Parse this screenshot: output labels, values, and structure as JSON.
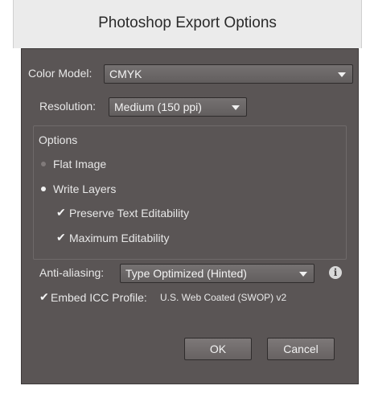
{
  "window": {
    "title": "Photoshop Export Options"
  },
  "color_model": {
    "label": "Color Model:",
    "value": "CMYK"
  },
  "resolution": {
    "label": "Resolution:",
    "value": "Medium (150 ppi)"
  },
  "options": {
    "heading": "Options",
    "flat_image": {
      "label": "Flat Image",
      "selected": false
    },
    "write_layers": {
      "label": "Write Layers",
      "selected": true
    },
    "preserve_text": {
      "label": "Preserve Text Editability",
      "checked": true
    },
    "max_edit": {
      "label": "Maximum Editability",
      "checked": true
    }
  },
  "anti_aliasing": {
    "label": "Anti-aliasing:",
    "value": "Type Optimized (Hinted)"
  },
  "embed_icc": {
    "label": "Embed ICC Profile:",
    "profile": "U.S. Web Coated (SWOP) v2",
    "checked": true
  },
  "buttons": {
    "ok": "OK",
    "cancel": "Cancel"
  },
  "colors": {
    "dialog_bg": "#5a5555",
    "text": "#e8e8e8"
  }
}
